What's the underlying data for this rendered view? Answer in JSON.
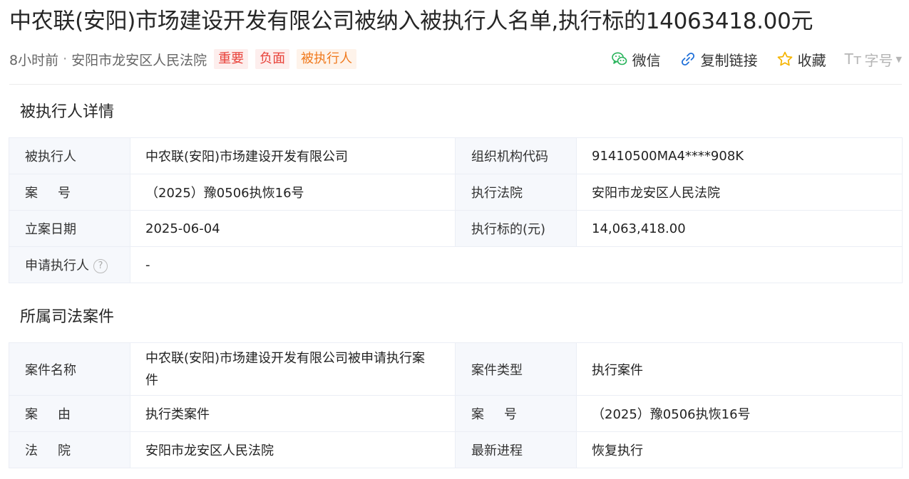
{
  "header": {
    "title": "中农联(安阳)市场建设开发有限公司被纳入被执行人名单,执行标的14063418.00元",
    "time": "8小时前",
    "separator": "·",
    "source": "安阳市龙安区人民法院",
    "tags": [
      "重要",
      "负面",
      "被执行人"
    ],
    "actions": {
      "wechat": "微信",
      "copy_link": "复制链接",
      "favorite": "收藏",
      "font_icon": "Tт",
      "font_size": "字号"
    }
  },
  "colors": {
    "tag_red": "#e8423a",
    "tag_orange": "#f07a1e",
    "link_blue": "#1e6fd9",
    "wechat_green": "#27b35a",
    "star_yellow": "#f5b400"
  },
  "icons": {
    "wechat": "wechat-icon",
    "link": "link-icon",
    "star": "star-icon",
    "font": "font-size-icon",
    "help": "question-circle-icon"
  },
  "executed_details": {
    "title": "被执行人详情",
    "rows": [
      {
        "label1": "被执行人",
        "value1": "中农联(安阳)市场建设开发有限公司",
        "label2": "组织机构代码",
        "value2": "91410500MA4****908K"
      },
      {
        "label1": "案号",
        "value1": "（2025）豫0506执恢16号",
        "label2": "执行法院",
        "value2": "安阳市龙安区人民法院"
      },
      {
        "label1": "立案日期",
        "value1": "2025-06-04",
        "label2": "执行标的(元)",
        "value2": "14,063,418.00"
      },
      {
        "label1": "申请执行人",
        "value1": "-",
        "help": "?"
      }
    ]
  },
  "judicial_case": {
    "title": "所属司法案件",
    "rows": [
      {
        "label1": "案件名称",
        "value1": "中农联(安阳)市场建设开发有限公司被申请执行案件",
        "label2": "案件类型",
        "value2": "执行案件"
      },
      {
        "label1": "案由",
        "value1": "执行类案件",
        "label2": "案号",
        "value2": "（2025）豫0506执恢16号"
      },
      {
        "label1": "法院",
        "value1": "安阳市龙安区人民法院",
        "label2": "最新进程",
        "value2": "恢复执行"
      }
    ]
  }
}
